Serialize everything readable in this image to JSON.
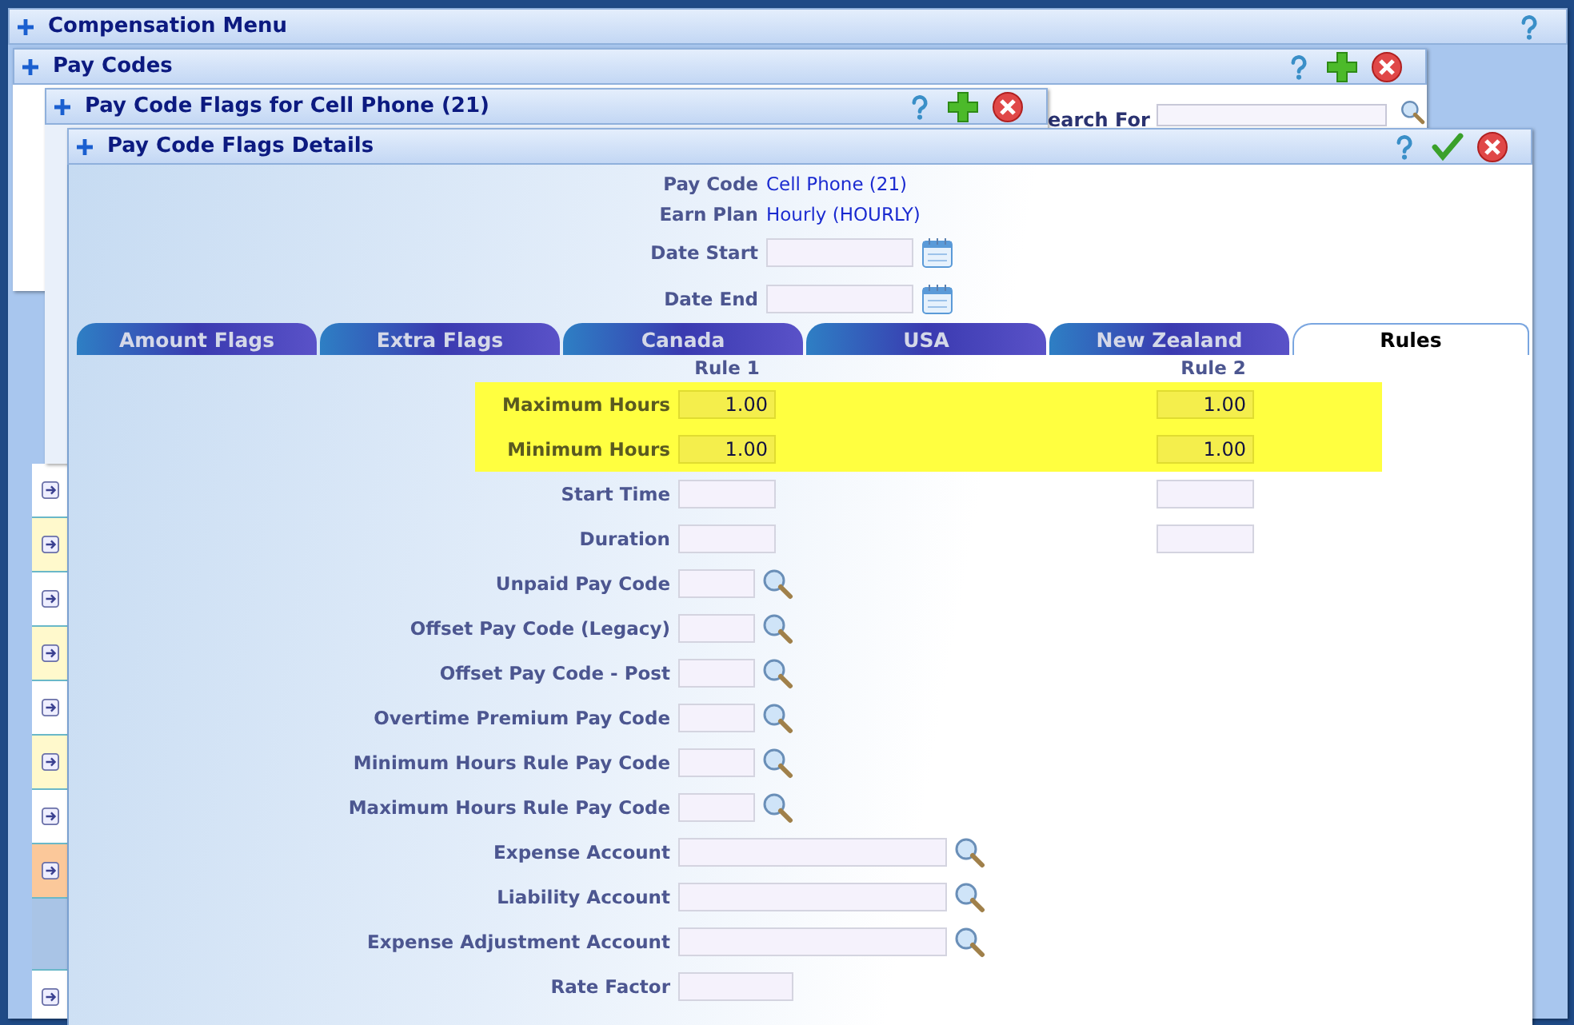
{
  "windows": [
    {
      "title": "Compensation Menu",
      "buttons": [
        {
          "kind": "help"
        }
      ]
    },
    {
      "title": "Pay Codes",
      "buttons": [
        {
          "kind": "help"
        },
        {
          "kind": "add"
        },
        {
          "kind": "close"
        }
      ]
    },
    {
      "title": "Pay Code Flags for Cell Phone (21)",
      "buttons": [
        {
          "kind": "help"
        },
        {
          "kind": "add"
        },
        {
          "kind": "close"
        }
      ]
    },
    {
      "title": "Pay Code Flags Details",
      "buttons": [
        {
          "kind": "help"
        },
        {
          "kind": "ok"
        },
        {
          "kind": "close"
        }
      ]
    }
  ],
  "search": {
    "label": "earch For"
  },
  "list_rows": [
    {
      "kind": "plain"
    },
    {
      "kind": "yellow"
    },
    {
      "kind": "plain"
    },
    {
      "kind": "yellow"
    },
    {
      "kind": "plain"
    },
    {
      "kind": "yellow"
    },
    {
      "kind": "plain"
    },
    {
      "kind": "selected"
    },
    {
      "kind": "sub"
    },
    {
      "kind": "plain"
    }
  ],
  "details": {
    "info": [
      {
        "label": "Pay Code",
        "value": "Cell Phone (21)"
      },
      {
        "label": "Earn Plan",
        "value": "Hourly (HOURLY)"
      }
    ],
    "dates": [
      {
        "label": "Date Start"
      },
      {
        "label": "Date End"
      }
    ],
    "tabs": [
      {
        "label": "Amount Flags",
        "selected": false
      },
      {
        "label": "Extra Flags",
        "selected": false
      },
      {
        "label": "Canada",
        "selected": false
      },
      {
        "label": "USA",
        "selected": false
      },
      {
        "label": "New Zealand",
        "selected": false
      },
      {
        "label": "Rules",
        "selected": true
      }
    ],
    "rule_columns": [
      "Rule 1",
      "Rule 2"
    ],
    "rule_rows": [
      {
        "label": "Maximum Hours",
        "highlighted": true,
        "rule_1": "1.00",
        "rule_2": "1.00"
      },
      {
        "label": "Minimum Hours",
        "highlighted": true,
        "rule_1": "1.00",
        "rule_2": "1.00"
      },
      {
        "label": "Start Time",
        "highlighted": false
      },
      {
        "label": "Duration",
        "highlighted": false
      }
    ],
    "fields": [
      {
        "label": "Unpaid Pay Code",
        "kind": "lookup"
      },
      {
        "label": "Offset Pay Code (Legacy)",
        "kind": "lookup"
      },
      {
        "label": "Offset Pay Code - Post",
        "kind": "lookup"
      },
      {
        "label": "Overtime Premium Pay Code",
        "kind": "lookup"
      },
      {
        "label": "Minimum Hours Rule Pay Code",
        "kind": "lookup"
      },
      {
        "label": "Maximum Hours Rule Pay Code",
        "kind": "lookup"
      },
      {
        "label": "Expense Account",
        "kind": "wide_lookup"
      },
      {
        "label": "Liability Account",
        "kind": "wide_lookup"
      },
      {
        "label": "Expense Adjustment Account",
        "kind": "wide_lookup"
      },
      {
        "label": "Rate Factor",
        "kind": "text"
      }
    ]
  }
}
